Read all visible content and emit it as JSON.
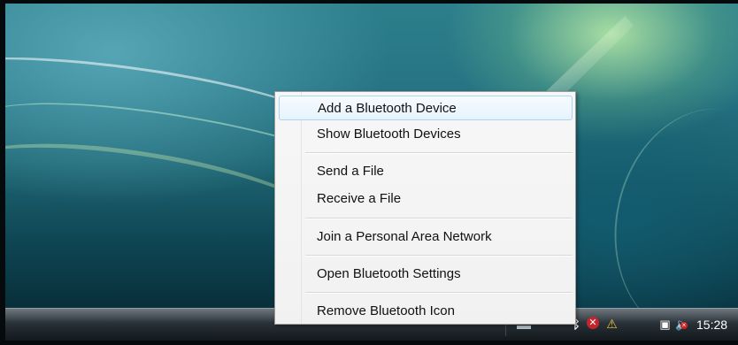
{
  "context_menu": {
    "items": [
      {
        "label": "Add a Bluetooth Device"
      },
      {
        "label": "Show Bluetooth Devices"
      },
      {
        "label": "Send a File"
      },
      {
        "label": "Receive a File"
      },
      {
        "label": "Join a Personal Area Network"
      },
      {
        "label": "Open Bluetooth Settings"
      },
      {
        "label": "Remove Bluetooth Icon"
      }
    ]
  },
  "taskbar": {
    "clock": "15:28",
    "tray_icons": [
      {
        "name": "bluetooth-icon",
        "glyph": "ᛒ"
      },
      {
        "name": "security-alert-icon",
        "glyph": "✕"
      },
      {
        "name": "warning-icon",
        "glyph": "⚠"
      },
      {
        "name": "network-disconnected-icon",
        "glyph": "▣"
      },
      {
        "name": "volume-muted-icon",
        "glyph": "🔈"
      }
    ]
  },
  "colors": {
    "menu_background": "#f3f3f3",
    "menu_border": "#9b9b9b",
    "highlight_border": "#a9d4f2",
    "highlight_fill": "#e7f3fc",
    "taskbar": "#293238",
    "clock_text": "#ffffff"
  }
}
